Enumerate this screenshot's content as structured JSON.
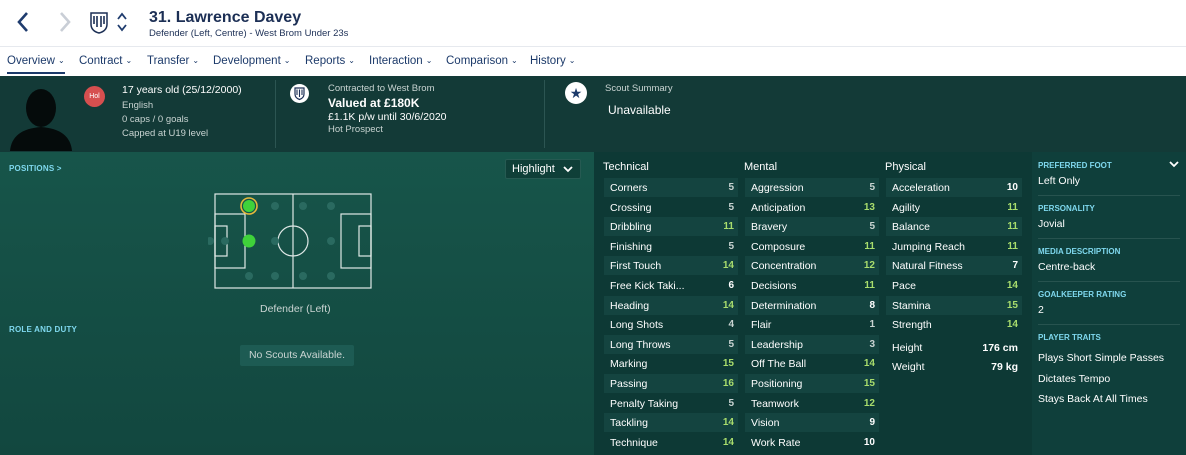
{
  "header": {
    "title": "31. Lawrence Davey",
    "subtitle": "Defender (Left, Centre) - West Brom Under 23s"
  },
  "menu": [
    {
      "label": "Overview",
      "active": true
    },
    {
      "label": "Contract"
    },
    {
      "label": "Transfer"
    },
    {
      "label": "Development"
    },
    {
      "label": "Reports"
    },
    {
      "label": "Interaction"
    },
    {
      "label": "Comparison"
    },
    {
      "label": "History"
    }
  ],
  "info": {
    "badge": "Hol",
    "age": "17 years old (25/12/2000)",
    "nationality": "English",
    "caps": "0 caps / 0 goals",
    "capped": "Capped at U19 level",
    "contract_label": "Contracted to West Brom",
    "value": "Valued at £180K",
    "wage": "£1.1K p/w until 30/6/2020",
    "status": "Hot Prospect",
    "scout_label": "Scout Summary",
    "scout_value": "Unavailable"
  },
  "left": {
    "positions_label": "POSITIONS >",
    "highlight_label": "Highlight",
    "position_text": "Defender (Left)",
    "role_label": "ROLE AND DUTY",
    "no_scouts": "No Scouts Available."
  },
  "attributes": {
    "technical_title": "Technical",
    "mental_title": "Mental",
    "physical_title": "Physical",
    "technical": [
      {
        "name": "Corners",
        "value": 5
      },
      {
        "name": "Crossing",
        "value": 5
      },
      {
        "name": "Dribbling",
        "value": 11
      },
      {
        "name": "Finishing",
        "value": 5
      },
      {
        "name": "First Touch",
        "value": 14
      },
      {
        "name": "Free Kick Taki...",
        "value": 6
      },
      {
        "name": "Heading",
        "value": 14
      },
      {
        "name": "Long Shots",
        "value": 4
      },
      {
        "name": "Long Throws",
        "value": 5
      },
      {
        "name": "Marking",
        "value": 15
      },
      {
        "name": "Passing",
        "value": 16
      },
      {
        "name": "Penalty Taking",
        "value": 5
      },
      {
        "name": "Tackling",
        "value": 14
      },
      {
        "name": "Technique",
        "value": 14
      }
    ],
    "mental": [
      {
        "name": "Aggression",
        "value": 5
      },
      {
        "name": "Anticipation",
        "value": 13
      },
      {
        "name": "Bravery",
        "value": 5
      },
      {
        "name": "Composure",
        "value": 11
      },
      {
        "name": "Concentration",
        "value": 12
      },
      {
        "name": "Decisions",
        "value": 11
      },
      {
        "name": "Determination",
        "value": 8
      },
      {
        "name": "Flair",
        "value": 1
      },
      {
        "name": "Leadership",
        "value": 3
      },
      {
        "name": "Off The Ball",
        "value": 14
      },
      {
        "name": "Positioning",
        "value": 15
      },
      {
        "name": "Teamwork",
        "value": 12
      },
      {
        "name": "Vision",
        "value": 9
      },
      {
        "name": "Work Rate",
        "value": 10
      }
    ],
    "physical": [
      {
        "name": "Acceleration",
        "value": 10
      },
      {
        "name": "Agility",
        "value": 11
      },
      {
        "name": "Balance",
        "value": 11
      },
      {
        "name": "Jumping Reach",
        "value": 11
      },
      {
        "name": "Natural Fitness",
        "value": 7
      },
      {
        "name": "Pace",
        "value": 14
      },
      {
        "name": "Stamina",
        "value": 15
      },
      {
        "name": "Strength",
        "value": 14
      }
    ],
    "height_label": "Height",
    "height_value": "176 cm",
    "weight_label": "Weight",
    "weight_value": "79 kg"
  },
  "right": {
    "foot_label": "PREFERRED FOOT",
    "foot_value": "Left Only",
    "personality_label": "PERSONALITY",
    "personality_value": "Jovial",
    "media_label": "MEDIA DESCRIPTION",
    "media_value": "Centre-back",
    "gk_label": "GOALKEEPER RATING",
    "gk_value": "2",
    "traits_label": "PLAYER TRAITS",
    "traits": [
      "Plays Short Simple Passes",
      "Dictates Tempo",
      "Stays Back At All Times"
    ]
  },
  "colors": {
    "low": "#c9d4d2",
    "mid": "#ffffff",
    "high": "#a9dd6d",
    "accent": "#7fd8ee",
    "highlight_dot": "#3fd23a"
  }
}
